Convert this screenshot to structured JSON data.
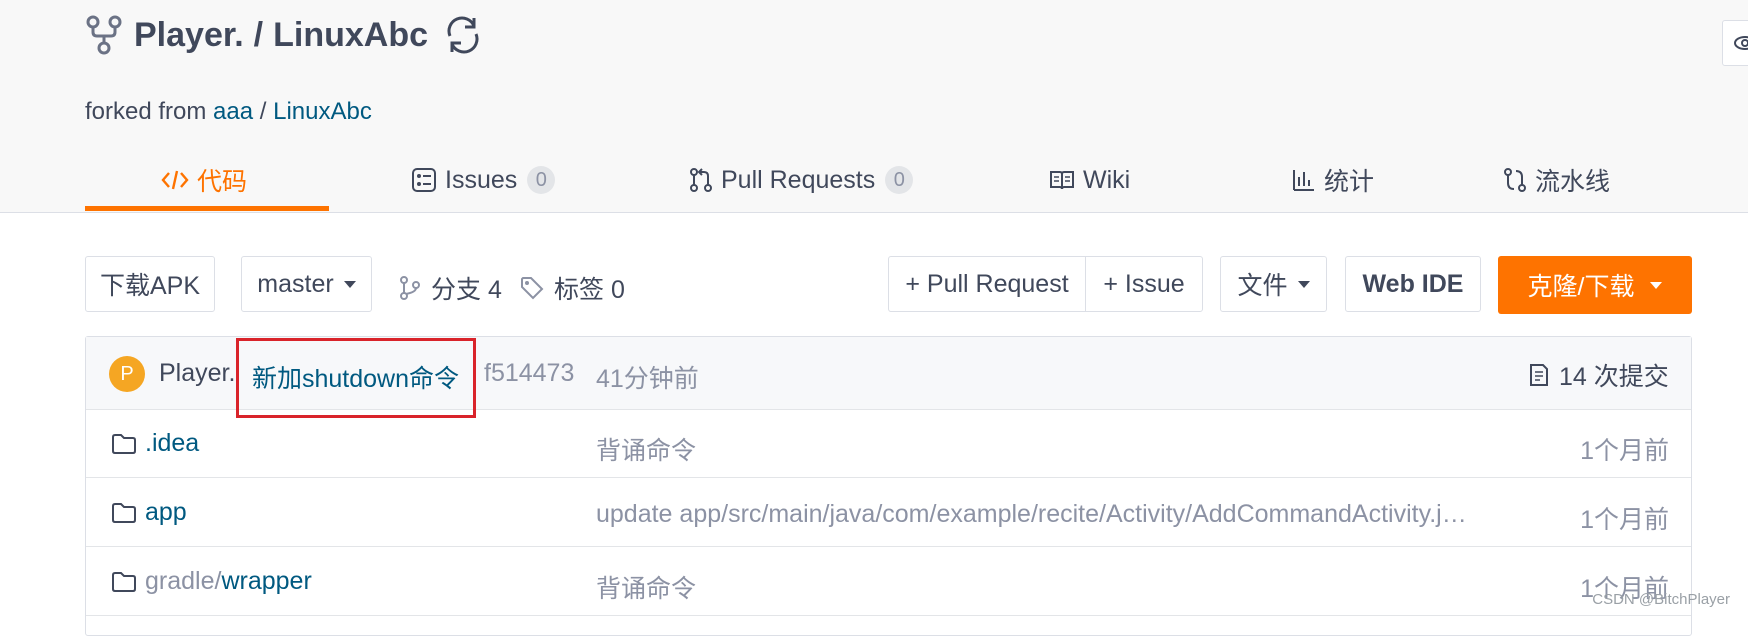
{
  "repo": {
    "owner": "Player.",
    "separator": "/",
    "name": "LinuxAbc",
    "forked_prefix": "forked from",
    "forked_owner": "aaa",
    "forked_sep": "/",
    "forked_repo": "LinuxAbc"
  },
  "tabs": [
    {
      "label": "代码",
      "icon": "code-icon",
      "active": true
    },
    {
      "label": "Issues",
      "count": "0",
      "icon": "issues-icon"
    },
    {
      "label": "Pull Requests",
      "count": "0",
      "icon": "pull-request-icon"
    },
    {
      "label": "Wiki",
      "icon": "book-icon"
    },
    {
      "label": "统计",
      "icon": "bar-chart-icon"
    },
    {
      "label": "流水线",
      "icon": "pipeline-icon"
    }
  ],
  "toolbar": {
    "download_apk": "下载APK",
    "branch": "master",
    "branches_label": "分支 4",
    "tags_label": "标签 0",
    "pull_request": "+ Pull Request",
    "issue": "+ Issue",
    "file": "文件",
    "web_ide": "Web IDE",
    "clone": "克隆/下载"
  },
  "commit": {
    "avatar_letter": "P",
    "author": "Player.",
    "message": "新加shutdown命令",
    "sha": "f514473",
    "time": "41分钟前",
    "count_label": "14 次提交"
  },
  "files": [
    {
      "name": ".idea",
      "message": "背诵命令",
      "time": "1个月前"
    },
    {
      "name": "app",
      "message": "update app/src/main/java/com/example/recite/Activity/AddCommandActivity.java.",
      "time": "1个月前"
    },
    {
      "name_dim": "gradle/",
      "name": "wrapper",
      "message": "背诵命令",
      "time": "1个月前"
    }
  ],
  "watermark": "CSDN @BitchPlayer",
  "colors": {
    "accent": "#fe7300",
    "link": "#005980",
    "highlight": "#d9232a"
  }
}
